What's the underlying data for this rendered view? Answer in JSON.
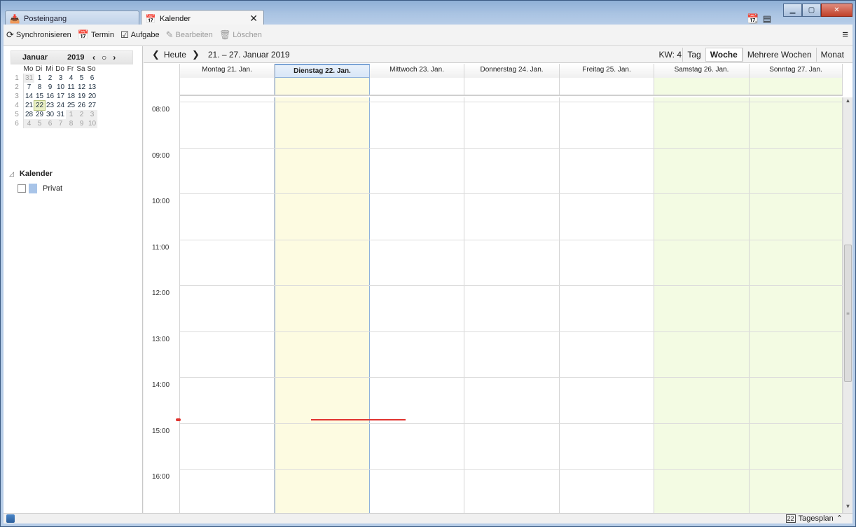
{
  "tabs": [
    {
      "label": "Posteingang",
      "icon": "inbox-icon"
    },
    {
      "label": "Kalender",
      "icon": "calendar-icon"
    }
  ],
  "tab_close": "✕",
  "toolbar": {
    "sync": "Synchronisieren",
    "event": "Termin",
    "task": "Aufgabe",
    "edit": "Bearbeiten",
    "delete": "Löschen"
  },
  "minical": {
    "month": "Januar",
    "year": "2019",
    "weekday_headers": [
      "Mo",
      "Di",
      "Mi",
      "Do",
      "Fr",
      "Sa",
      "So"
    ],
    "weeks": [
      {
        "wk": "1",
        "days": [
          "31",
          "1",
          "2",
          "3",
          "4",
          "5",
          "6"
        ]
      },
      {
        "wk": "2",
        "days": [
          "7",
          "8",
          "9",
          "10",
          "11",
          "12",
          "13"
        ]
      },
      {
        "wk": "3",
        "days": [
          "14",
          "15",
          "16",
          "17",
          "18",
          "19",
          "20"
        ]
      },
      {
        "wk": "4",
        "days": [
          "21",
          "22",
          "23",
          "24",
          "25",
          "26",
          "27"
        ]
      },
      {
        "wk": "5",
        "days": [
          "28",
          "29",
          "30",
          "31",
          "1",
          "2",
          "3"
        ]
      },
      {
        "wk": "6",
        "days": [
          "4",
          "5",
          "6",
          "7",
          "8",
          "9",
          "10"
        ]
      }
    ],
    "today": "22"
  },
  "calendars": {
    "title": "Kalender",
    "items": [
      {
        "name": "Privat",
        "color": "#a8c4e8"
      }
    ]
  },
  "nav": {
    "today": "Heute",
    "range": "21. – 27. Januar 2019",
    "week_no": "KW: 4"
  },
  "views": [
    "Tag",
    "Woche",
    "Mehrere Wochen",
    "Monat"
  ],
  "active_view": "Woche",
  "days": [
    {
      "label": "Montag 21. Jan.",
      "type": "normal"
    },
    {
      "label": "Dienstag 22. Jan.",
      "type": "today"
    },
    {
      "label": "Mittwoch 23. Jan.",
      "type": "normal"
    },
    {
      "label": "Donnerstag 24. Jan.",
      "type": "normal"
    },
    {
      "label": "Freitag 25. Jan.",
      "type": "normal"
    },
    {
      "label": "Samstag 26. Jan.",
      "type": "weekend"
    },
    {
      "label": "Sonntag 27. Jan.",
      "type": "weekend"
    }
  ],
  "hours": [
    "08:00",
    "09:00",
    "10:00",
    "11:00",
    "12:00",
    "13:00",
    "14:00",
    "15:00",
    "16:00"
  ],
  "current_time": "14:55",
  "status": {
    "tagesplan": "Tagesplan",
    "tagesplan_day": "22"
  }
}
